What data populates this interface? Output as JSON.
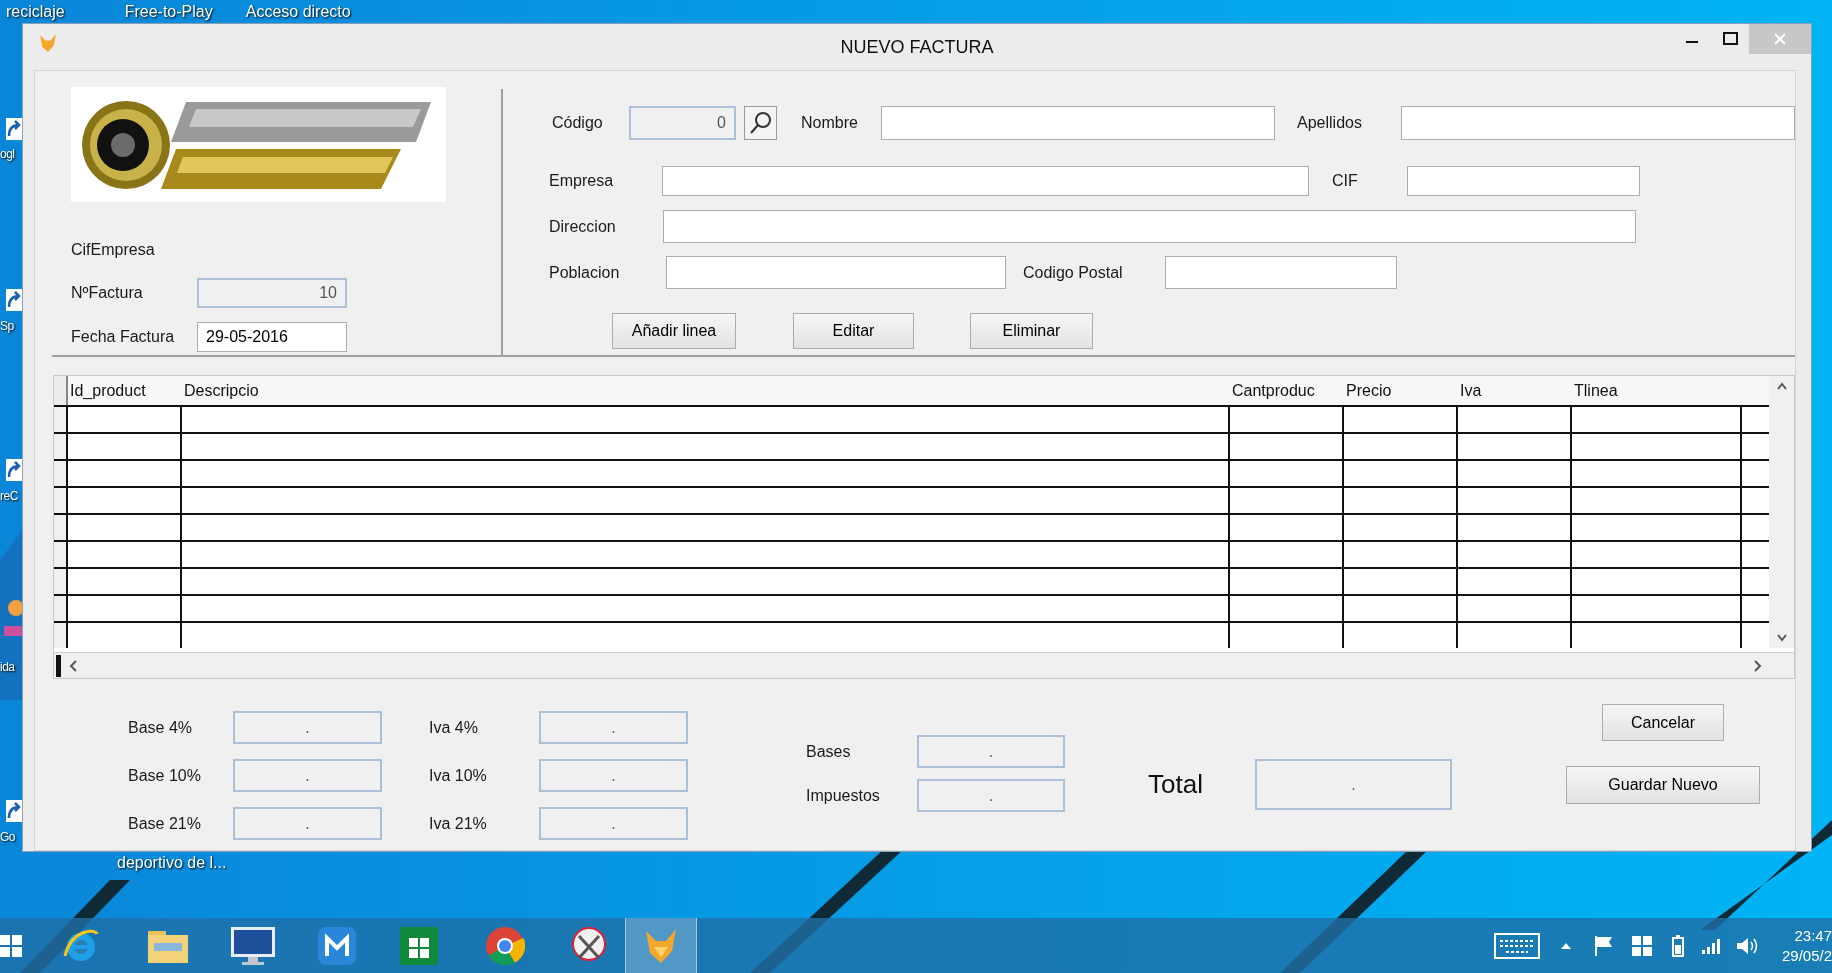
{
  "desktop": {
    "top_labels": [
      "reciclaje",
      "Free-to-Play",
      "Acceso directo"
    ],
    "side_labels": [
      "ogl",
      "Sp",
      "reC",
      "ida",
      "Go"
    ],
    "bottom_label": "deportivo de l..."
  },
  "window": {
    "title": "NUEVO FACTURA"
  },
  "invoice": {
    "company_cif_label": "CifEmpresa",
    "number": {
      "label": "NºFactura",
      "value": "10",
      "disabled": true
    },
    "date": {
      "label": "Fecha Factura",
      "value": "29-05-2016",
      "disabled": false
    }
  },
  "client": {
    "rows": [
      {
        "fields": [
          {
            "label": "Código",
            "value": "0",
            "disabled": true,
            "search": true
          },
          {
            "label": "Nombre",
            "disabled": false
          },
          {
            "label": "Apellidos",
            "disabled": false
          }
        ]
      },
      {
        "fields": [
          {
            "label": "Empresa",
            "disabled": false
          },
          {
            "label": "CIF",
            "disabled": false
          }
        ]
      },
      {
        "fields": [
          {
            "label": "Direccion",
            "disabled": false
          }
        ]
      },
      {
        "fields": [
          {
            "label": "Poblacion",
            "disabled": false
          },
          {
            "label": "Codigo Postal",
            "disabled": false
          }
        ]
      }
    ]
  },
  "line_buttons": [
    "Añadir linea",
    "Editar",
    "Eliminar"
  ],
  "table": {
    "columns": [
      "Id_product",
      "Descripcio",
      "Cantproduc",
      "Precio",
      "Iva",
      "Tlinea"
    ]
  },
  "totals": {
    "rates": [
      {
        "base": {
          "label": "Base 4%",
          "value": ".",
          "disabled": true
        },
        "tax": {
          "label": "Iva 4%",
          "value": ".",
          "disabled": true
        }
      },
      {
        "base": {
          "label": "Base 10%",
          "value": ".",
          "disabled": true
        },
        "tax": {
          "label": "Iva 10%",
          "value": ".",
          "disabled": true
        }
      },
      {
        "base": {
          "label": "Base 21%",
          "value": ".",
          "disabled": true
        },
        "tax": {
          "label": "Iva 21%",
          "value": ".",
          "disabled": true
        }
      }
    ],
    "summary": [
      {
        "label": "Bases",
        "value": ".",
        "disabled": true
      },
      {
        "label": "Impuestos",
        "value": ".",
        "disabled": true
      }
    ],
    "total": {
      "label": "Total",
      "value": ".",
      "disabled": true
    }
  },
  "buttons": [
    "Cancelar",
    "Guardar Nuevo"
  ],
  "taskbar": {
    "apps": [
      {
        "kind": "ie",
        "selected": false
      },
      {
        "kind": "explorer",
        "selected": false
      },
      {
        "kind": "monitor",
        "selected": false
      },
      {
        "kind": "maxthon",
        "selected": false
      },
      {
        "kind": "store",
        "selected": false
      },
      {
        "kind": "chrome",
        "selected": false
      },
      {
        "kind": "snipping",
        "selected": false
      },
      {
        "kind": "fox",
        "selected": true
      }
    ],
    "clock": {
      "time": "23:47",
      "date": "29/05/2"
    }
  }
}
